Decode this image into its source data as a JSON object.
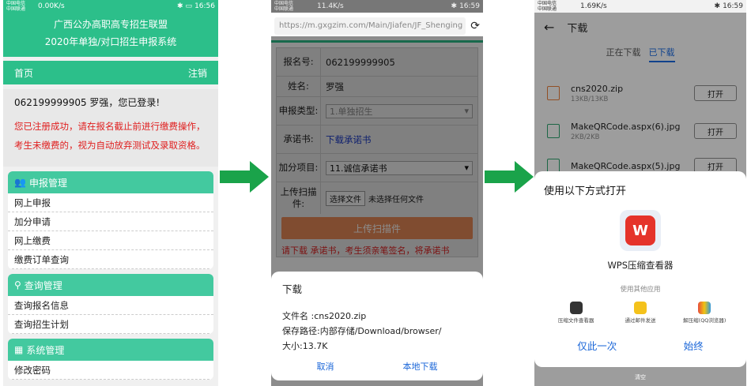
{
  "colors": {
    "green": "#2cbf8a",
    "arrow": "#1aa34a",
    "red": "#e02020",
    "blue": "#1a66d8",
    "orange": "#e98a58"
  },
  "p1": {
    "status": {
      "carrier1": "中国电信",
      "carrier2": "中国联通",
      "speed": "0.00K/s",
      "time": "16:56"
    },
    "title1": "广西公办高职高专招生联盟",
    "title2": "2020年单独/对口招生申报系统",
    "nav": {
      "home": "首页",
      "logout": "注销"
    },
    "welcome": "062199999905 罗强，您已登录!",
    "warn1": "您已注册成功，请在报名截止前进行缴费操作，",
    "warn2": "考生未缴费的，视为自动放弃测试及录取资格。",
    "menus": [
      {
        "title": "申报管理",
        "items": [
          "网上申报",
          "加分申请",
          "网上缴费",
          "缴费订单查询"
        ]
      },
      {
        "title": "查询管理",
        "items": [
          "查询报名信息",
          "查询招生计划"
        ]
      },
      {
        "title": "系统管理",
        "items": [
          "修改密码"
        ]
      }
    ]
  },
  "p2": {
    "status": {
      "carrier1": "中国电信",
      "carrier2": "中国联通",
      "speed": "11.4K/s",
      "time": "16:59"
    },
    "url": "https://m.gxgzim.com/Main/Jiafen/JF_Shenging",
    "rows": {
      "reg_k": "报名号:",
      "reg_v": "062199999905",
      "name_k": "姓名:",
      "name_v": "罗强",
      "type_k": "申报类型:",
      "type_v": "1.单独招生",
      "pledge_k": "承诺书:",
      "pledge_v": "下载承诺书",
      "bonus_k": "加分项目:",
      "bonus_v": "11.诚信承诺书",
      "upload_k": "上传扫描件:",
      "choose": "选择文件",
      "nofile": "未选择任何文件"
    },
    "upload_btn": "上传扫描件",
    "note": "请下载 承诺书，考生须亲笔签名，将承诺书",
    "dialog": {
      "title": "下载",
      "file": "文件名 :cns2020.zip",
      "path": "保存路径:内部存储/Download/browser/",
      "size": "大小:13.7K",
      "cancel": "取消",
      "local": "本地下载"
    }
  },
  "p3": {
    "status": {
      "carrier1": "中国电信",
      "carrier2": "中国联通",
      "speed": "1.69K/s",
      "time": "16:59"
    },
    "title": "下载",
    "tabs": [
      "正在下载",
      "已下载"
    ],
    "files": [
      {
        "name": "cns2020.zip",
        "size": "13KB/13KB",
        "open": "打开"
      },
      {
        "name": "MakeQRCode.aspx(6).jpg",
        "size": "2KB/2KB",
        "open": "打开"
      },
      {
        "name": "MakeQRCode.aspx(5).jpg",
        "size": "",
        "open": "打开"
      }
    ],
    "sheet": {
      "title": "使用以下方式打开",
      "app": "WPS压缩查看器",
      "other": "使用其他应用",
      "apps": [
        "压缩文件查看器",
        "通过邮件发送",
        "解压缩(QQ浏览器)"
      ],
      "once": "仅此一次",
      "always": "始终"
    },
    "bottom": "清空"
  }
}
